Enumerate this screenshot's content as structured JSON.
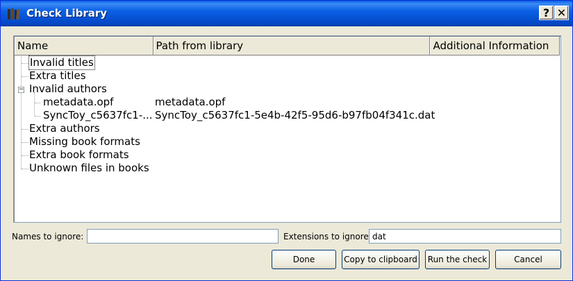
{
  "window": {
    "title": "Check Library",
    "help_label": "?",
    "close_label": "✕",
    "icon": "books-icon"
  },
  "tree": {
    "columns": [
      "Name",
      "Path from library",
      "Additional Information"
    ],
    "rows": [
      {
        "name": "Invalid titles",
        "path": ""
      },
      {
        "name": "Extra titles",
        "path": ""
      },
      {
        "name": "Invalid authors",
        "path": "",
        "expander": "−"
      },
      {
        "name": "metadata.opf",
        "path": "metadata.opf"
      },
      {
        "name": "SyncToy_c5637fc1-...",
        "path": "SyncToy_c5637fc1-5e4b-42f5-95d6-b97fb04f341c.dat"
      },
      {
        "name": "Extra authors",
        "path": ""
      },
      {
        "name": "Missing book formats",
        "path": ""
      },
      {
        "name": "Extra book formats",
        "path": ""
      },
      {
        "name": "Unknown files in books",
        "path": ""
      }
    ]
  },
  "filters": {
    "names_label": "Names to ignore:",
    "names_value": "",
    "extensions_label": "Extensions to ignore",
    "extensions_value": "dat"
  },
  "buttons": {
    "done": "Done",
    "copy": "Copy to clipboard",
    "run": "Run the check",
    "cancel": "Cancel"
  },
  "colors": {
    "titlebar": "#0a5fe4",
    "dialog_bg": "#ece9d8",
    "border": "#7f9db9"
  }
}
